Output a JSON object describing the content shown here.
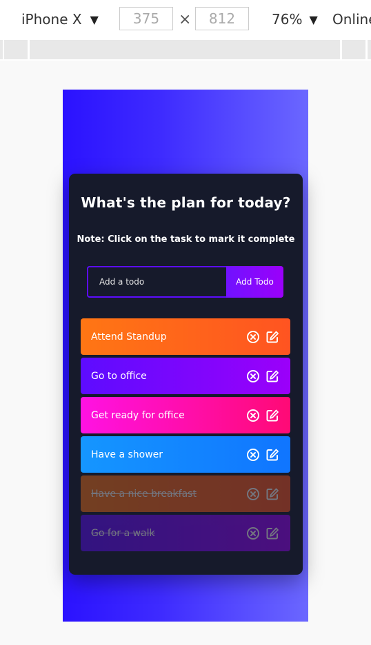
{
  "devtools": {
    "device_name": "iPhone X",
    "width": "375",
    "height": "812",
    "times_symbol": "×",
    "zoom": "76%",
    "network": "Online",
    "caret": "▼"
  },
  "app": {
    "title": "What's the plan for today?",
    "note": "Note: Click on the task to mark it complete",
    "input_placeholder": "Add a todo",
    "add_button": "Add Todo"
  },
  "todos": [
    {
      "text": "Attend Standup",
      "complete": false,
      "gradient": [
        "#ff7614",
        "#ff5421"
      ]
    },
    {
      "text": "Go to office",
      "complete": false,
      "gradient": [
        "#5d0cff",
        "#9b00fa"
      ]
    },
    {
      "text": "Get ready for office",
      "complete": false,
      "gradient": [
        "#ff12e3",
        "#ff0a75"
      ]
    },
    {
      "text": "Have a shower",
      "complete": false,
      "gradient": [
        "#1596ff",
        "#1075ff"
      ]
    },
    {
      "text": "Have a nice breakfast",
      "complete": true,
      "gradient": [
        "#ff7614",
        "#ff5421"
      ]
    },
    {
      "text": "Go for a walk",
      "complete": true,
      "gradient": [
        "#5d0cff",
        "#9b00fa"
      ]
    }
  ],
  "icons": {
    "delete": "close-circle-icon",
    "edit": "edit-icon"
  }
}
